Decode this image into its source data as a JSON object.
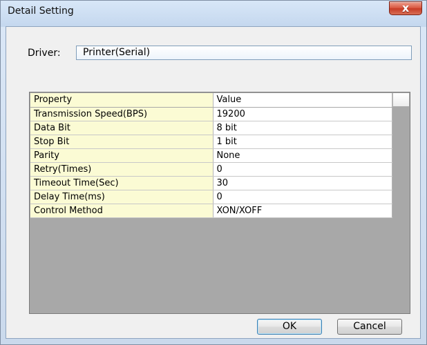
{
  "window": {
    "title": "Detail Setting",
    "close_symbol": "x"
  },
  "driver": {
    "label": "Driver:",
    "value": "Printer(Serial)"
  },
  "table": {
    "columns": [
      "Property",
      "Value"
    ],
    "rows": [
      {
        "property": "Transmission Speed(BPS)",
        "value": "19200"
      },
      {
        "property": "Data Bit",
        "value": "8 bit"
      },
      {
        "property": "Stop Bit",
        "value": "1 bit"
      },
      {
        "property": "Parity",
        "value": "None"
      },
      {
        "property": "Retry(Times)",
        "value": "0"
      },
      {
        "property": "Timeout Time(Sec)",
        "value": "30"
      },
      {
        "property": "Delay Time(ms)",
        "value": "0"
      },
      {
        "property": "Control Method",
        "value": "XON/XOFF"
      }
    ]
  },
  "buttons": {
    "ok": "OK",
    "cancel": "Cancel"
  },
  "colors": {
    "property_cell": "#fbfbd4",
    "table_background": "#a8a8a8",
    "close_button": "#c73b25"
  }
}
